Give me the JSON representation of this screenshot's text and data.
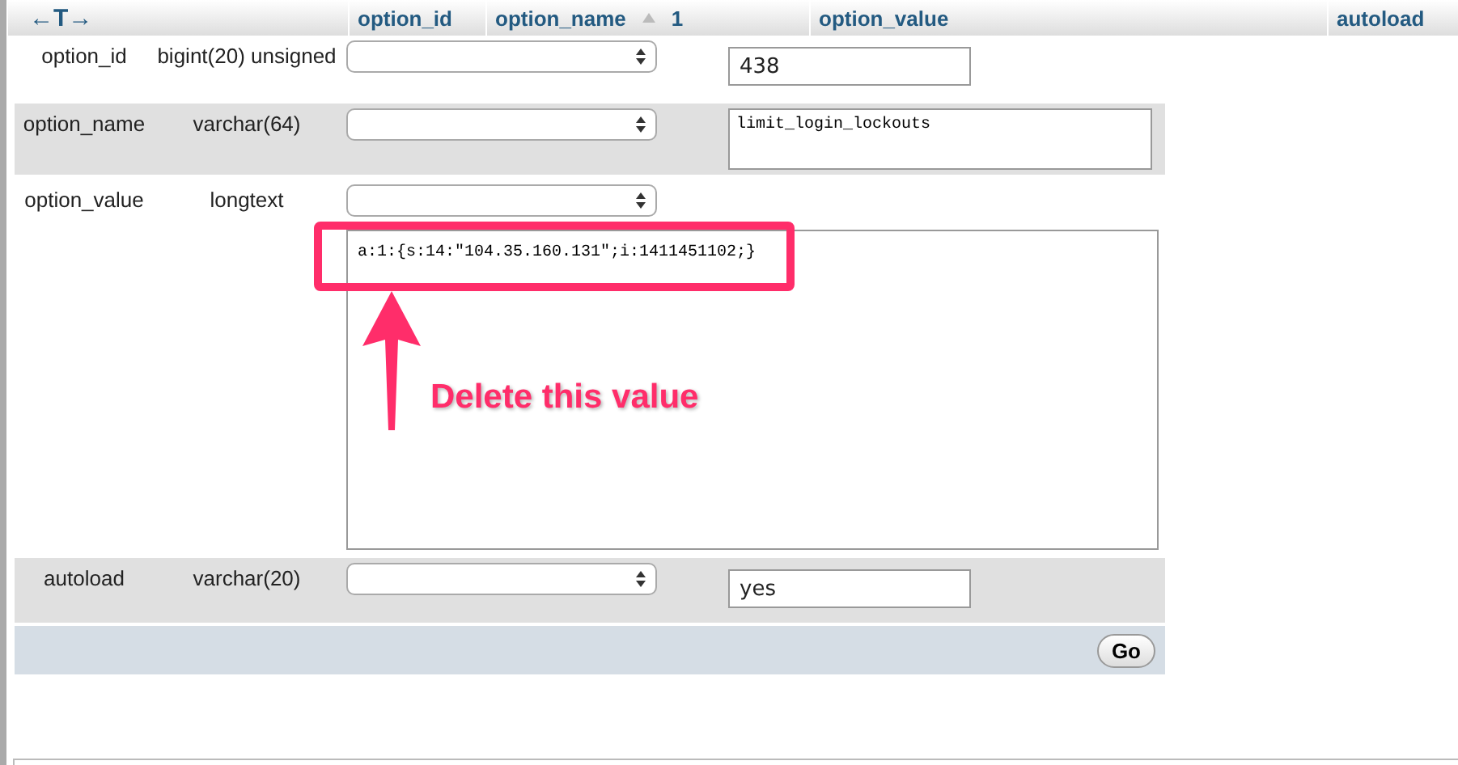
{
  "header": {
    "arrows": "←T→",
    "columns": [
      {
        "label": "option_id"
      },
      {
        "label": "option_name",
        "sort": "1"
      },
      {
        "label": "option_value"
      },
      {
        "label": "autoload"
      }
    ]
  },
  "fields": [
    {
      "name": "option_id",
      "type": "bigint(20) unsigned",
      "value": "438",
      "kind": "input"
    },
    {
      "name": "option_name",
      "type": "varchar(64)",
      "value": "limit_login_lockouts",
      "kind": "textarea"
    },
    {
      "name": "option_value",
      "type": "longtext",
      "value": "a:1:{s:14:\"104.35.160.131\";i:1411451102;}",
      "kind": "bigtext"
    },
    {
      "name": "autoload",
      "type": "varchar(20)",
      "value": "yes",
      "kind": "input"
    }
  ],
  "button": "Go",
  "annotation": {
    "label": "Delete this value"
  }
}
